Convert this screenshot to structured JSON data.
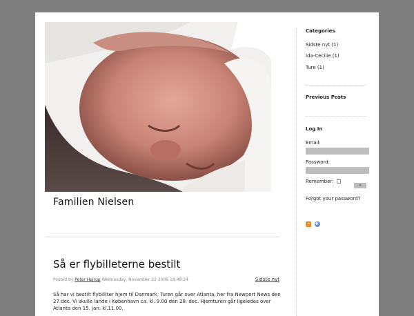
{
  "site": {
    "title": "Familien Nielsen"
  },
  "post": {
    "title": "Så er flybilleterne bestilt",
    "meta_prefix": "Posted by",
    "author": "Peter Højrup",
    "date": "Wednesday, November 22 2006 18:48:24",
    "category": "Sidste nyt",
    "body": "Så har vi bestilt flybilliter hjem til Danmark. Turen går over Atlanta, her fra Newport News den 27.dec. Vi skulle lande i København ca. kl. 9.00 den 28. dec. Hjemturen går ligeledes over Atlanta den 15. jan. kl.11.00."
  },
  "sidebar": {
    "categories_title": "Categories",
    "categories": [
      {
        "label": "Sidste nyt (1)"
      },
      {
        "label": "Ida-Cecilie (1)"
      },
      {
        "label": "Ture (1)"
      }
    ],
    "previous_posts_title": "Previous Posts",
    "login": {
      "title": "Log In",
      "email_label": "Email:",
      "password_label": "Password:",
      "remember_label": "Remember:",
      "submit_label": "»",
      "forgot_label": "Forgot your password?"
    },
    "icons": [
      "rss-icon",
      "badge-icon"
    ]
  }
}
